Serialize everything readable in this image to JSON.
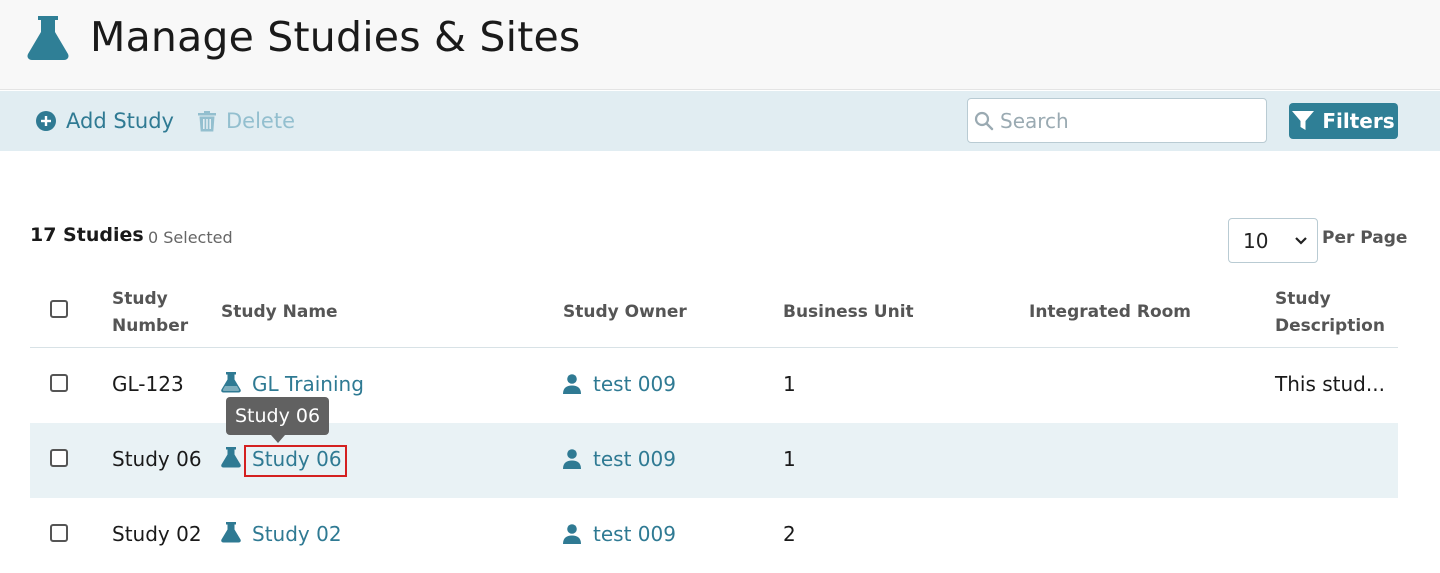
{
  "header": {
    "title": "Manage Studies & Sites",
    "logo_icon": "flask-icon"
  },
  "toolbar": {
    "add_label": "Add Study",
    "delete_label": "Delete",
    "search_placeholder": "Search",
    "search_value": "",
    "filters_label": "Filters"
  },
  "summary": {
    "count": "17 Studies",
    "selected": "0 Selected"
  },
  "pagination": {
    "per_page_value": "10",
    "per_page_label": "Per Page"
  },
  "table": {
    "columns": {
      "study_number": "Study Number",
      "study_name": "Study Name",
      "study_owner": "Study Owner",
      "business_unit": "Business Unit",
      "integrated_room": "Integrated Room",
      "study_description": "Study Description"
    },
    "rows": [
      {
        "number": "GL-123",
        "name": "GL Training",
        "owner": "test 009",
        "business_unit": "1",
        "integrated_room": "",
        "description": "This stud..."
      },
      {
        "number": "Study 06",
        "name": "Study 06",
        "owner": "test 009",
        "business_unit": "1",
        "integrated_room": "",
        "description": ""
      },
      {
        "number": "Study 02",
        "name": "Study 02",
        "owner": "test 009",
        "business_unit": "2",
        "integrated_room": "",
        "description": ""
      }
    ]
  },
  "tooltip": {
    "text": "Study 06"
  },
  "colors": {
    "accent": "#2f7a93",
    "toolbar_bg": "#e1edf2",
    "row_highlight": "#e9f2f5",
    "focus_outline": "#d42020"
  }
}
